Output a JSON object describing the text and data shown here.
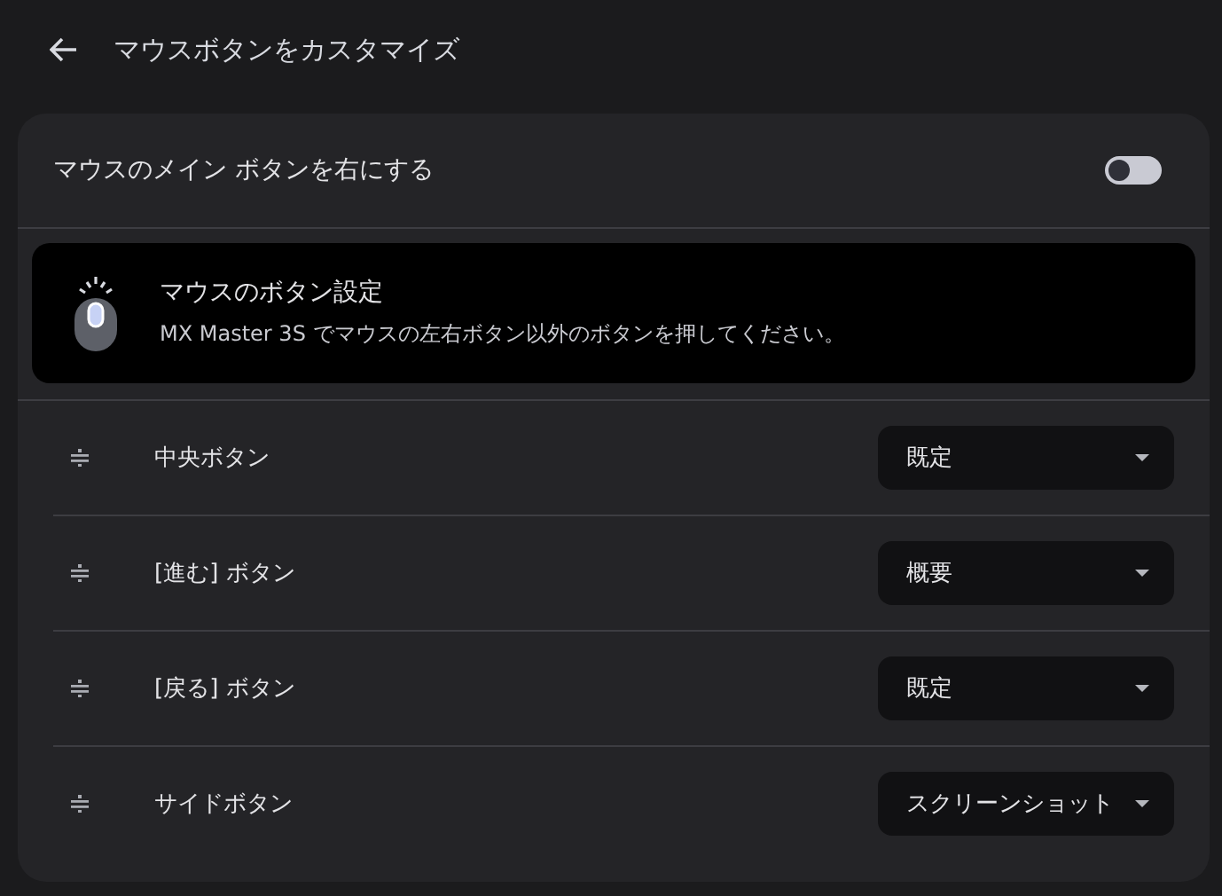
{
  "header": {
    "title": "マウスボタンをカスタマイズ"
  },
  "primary_toggle": {
    "label": "マウスのメイン ボタンを右にする",
    "on": false
  },
  "banner": {
    "title": "マウスのボタン設定",
    "description": "MX Master 3S でマウスの左右ボタン以外のボタンを押してください。"
  },
  "buttons": [
    {
      "label": "中央ボタン",
      "action": "既定"
    },
    {
      "label": "[進む] ボタン",
      "action": "概要"
    },
    {
      "label": "[戻る] ボタン",
      "action": "既定"
    },
    {
      "label": "サイドボタン",
      "action": "スクリーンショット"
    }
  ]
}
